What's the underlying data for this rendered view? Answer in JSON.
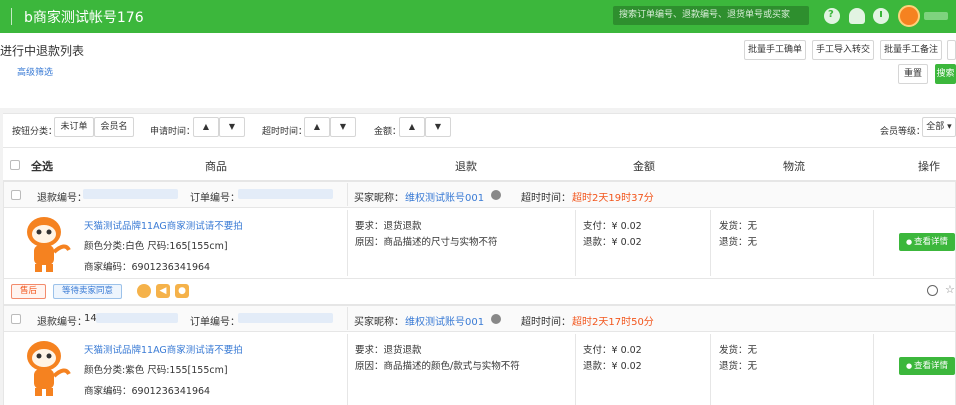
{
  "header": {
    "title": "b商家测试帐号176",
    "search_placeholder": "搜索订单编号、退款编号、退货单号或买家"
  },
  "page": {
    "title": "进行中退款列表",
    "advanced_filter": "高级筛选"
  },
  "toolbar": {
    "btn1": "批量手工确单",
    "btn2": "手工导入转交",
    "btn3": "批量手工备注",
    "reset": "重置",
    "search": "搜索"
  },
  "filters": {
    "sort_label": "按钮分类：",
    "opt1": "未订单",
    "opt2": "会员名",
    "apply_time": "申请时间：",
    "timeout": "超时时间：",
    "amount": "金额：",
    "member_level": "会员等级：",
    "member_level_value": "全部"
  },
  "columns": {
    "select_all": "全选",
    "product": "商品",
    "refund": "退款",
    "amount": "金额",
    "logistics": "物流",
    "action": "操作"
  },
  "orders": [
    {
      "refund_no_label": "退款编号：",
      "refund_no": "",
      "order_no_label": "订单编号：",
      "order_no": "",
      "buyer_label": "买家昵称：",
      "buyer": "维权测试账号001",
      "timeout_label": "超时时间：",
      "timeout": "超时2天19时37分",
      "product_title": "天猫测试品牌11AG商家测试请不要拍",
      "product_spec": "颜色分类:白色 尺码:165[155cm]",
      "product_code": "商家编码：6901236341964",
      "refund_req": "要求：退货退款",
      "refund_reason": "原因：商品描述的尺寸与实物不符",
      "pay": "支付：¥ 0.02",
      "refund_amt": "退款：¥ 0.02",
      "ship": "发货：无",
      "return": "退货：无",
      "detail": "查看详情"
    },
    {
      "refund_no_label": "退款编号：",
      "refund_no": "14",
      "order_no_label": "订单编号：",
      "order_no": "",
      "buyer_label": "买家昵称：",
      "buyer": "维权测试账号001",
      "timeout_label": "超时时间：",
      "timeout": "超时2天17时50分",
      "product_title": "天猫测试品牌11AG商家测试请不要拍",
      "product_spec": "颜色分类:紫色 尺码:155[155cm]",
      "product_code": "商家编码：6901236341964",
      "refund_req": "要求：退货退款",
      "refund_reason": "原因：商品描述的颜色/款式与实物不符",
      "pay": "支付：¥ 0.02",
      "refund_amt": "退款：¥ 0.02",
      "ship": "发货：无",
      "return": "退货：无",
      "detail": "查看详情"
    }
  ],
  "tags": {
    "aftersale": "售后",
    "status": "等待卖家同意"
  },
  "colors": {
    "brand_green": "#3cb73c",
    "link_blue": "#3a7bd5",
    "alert_red": "#f2561d"
  }
}
